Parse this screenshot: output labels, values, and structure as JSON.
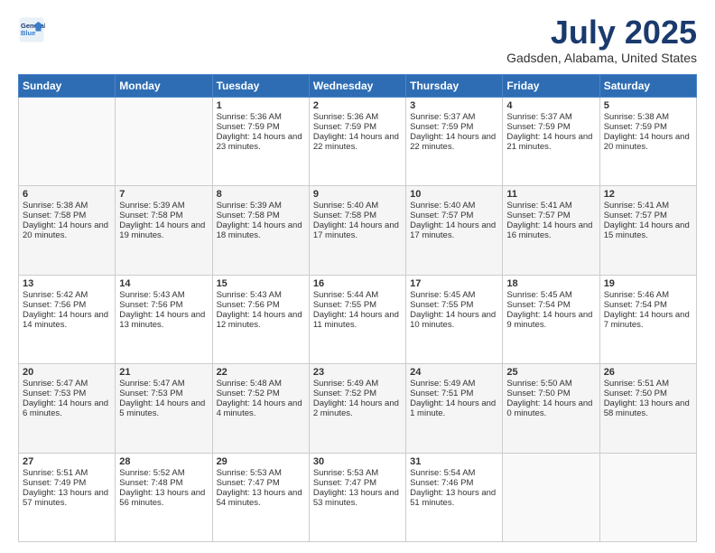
{
  "logo": {
    "line1": "General",
    "line2": "Blue"
  },
  "title": "July 2025",
  "subtitle": "Gadsden, Alabama, United States",
  "days_header": [
    "Sunday",
    "Monday",
    "Tuesday",
    "Wednesday",
    "Thursday",
    "Friday",
    "Saturday"
  ],
  "weeks": [
    [
      null,
      null,
      {
        "day": 1,
        "sunrise": "5:36 AM",
        "sunset": "7:59 PM",
        "daylight": "14 hours and 23 minutes."
      },
      {
        "day": 2,
        "sunrise": "5:36 AM",
        "sunset": "7:59 PM",
        "daylight": "14 hours and 22 minutes."
      },
      {
        "day": 3,
        "sunrise": "5:37 AM",
        "sunset": "7:59 PM",
        "daylight": "14 hours and 22 minutes."
      },
      {
        "day": 4,
        "sunrise": "5:37 AM",
        "sunset": "7:59 PM",
        "daylight": "14 hours and 21 minutes."
      },
      {
        "day": 5,
        "sunrise": "5:38 AM",
        "sunset": "7:59 PM",
        "daylight": "14 hours and 20 minutes."
      }
    ],
    [
      {
        "day": 6,
        "sunrise": "5:38 AM",
        "sunset": "7:58 PM",
        "daylight": "14 hours and 20 minutes."
      },
      {
        "day": 7,
        "sunrise": "5:39 AM",
        "sunset": "7:58 PM",
        "daylight": "14 hours and 19 minutes."
      },
      {
        "day": 8,
        "sunrise": "5:39 AM",
        "sunset": "7:58 PM",
        "daylight": "14 hours and 18 minutes."
      },
      {
        "day": 9,
        "sunrise": "5:40 AM",
        "sunset": "7:58 PM",
        "daylight": "14 hours and 17 minutes."
      },
      {
        "day": 10,
        "sunrise": "5:40 AM",
        "sunset": "7:57 PM",
        "daylight": "14 hours and 17 minutes."
      },
      {
        "day": 11,
        "sunrise": "5:41 AM",
        "sunset": "7:57 PM",
        "daylight": "14 hours and 16 minutes."
      },
      {
        "day": 12,
        "sunrise": "5:41 AM",
        "sunset": "7:57 PM",
        "daylight": "14 hours and 15 minutes."
      }
    ],
    [
      {
        "day": 13,
        "sunrise": "5:42 AM",
        "sunset": "7:56 PM",
        "daylight": "14 hours and 14 minutes."
      },
      {
        "day": 14,
        "sunrise": "5:43 AM",
        "sunset": "7:56 PM",
        "daylight": "14 hours and 13 minutes."
      },
      {
        "day": 15,
        "sunrise": "5:43 AM",
        "sunset": "7:56 PM",
        "daylight": "14 hours and 12 minutes."
      },
      {
        "day": 16,
        "sunrise": "5:44 AM",
        "sunset": "7:55 PM",
        "daylight": "14 hours and 11 minutes."
      },
      {
        "day": 17,
        "sunrise": "5:45 AM",
        "sunset": "7:55 PM",
        "daylight": "14 hours and 10 minutes."
      },
      {
        "day": 18,
        "sunrise": "5:45 AM",
        "sunset": "7:54 PM",
        "daylight": "14 hours and 9 minutes."
      },
      {
        "day": 19,
        "sunrise": "5:46 AM",
        "sunset": "7:54 PM",
        "daylight": "14 hours and 7 minutes."
      }
    ],
    [
      {
        "day": 20,
        "sunrise": "5:47 AM",
        "sunset": "7:53 PM",
        "daylight": "14 hours and 6 minutes."
      },
      {
        "day": 21,
        "sunrise": "5:47 AM",
        "sunset": "7:53 PM",
        "daylight": "14 hours and 5 minutes."
      },
      {
        "day": 22,
        "sunrise": "5:48 AM",
        "sunset": "7:52 PM",
        "daylight": "14 hours and 4 minutes."
      },
      {
        "day": 23,
        "sunrise": "5:49 AM",
        "sunset": "7:52 PM",
        "daylight": "14 hours and 2 minutes."
      },
      {
        "day": 24,
        "sunrise": "5:49 AM",
        "sunset": "7:51 PM",
        "daylight": "14 hours and 1 minute."
      },
      {
        "day": 25,
        "sunrise": "5:50 AM",
        "sunset": "7:50 PM",
        "daylight": "14 hours and 0 minutes."
      },
      {
        "day": 26,
        "sunrise": "5:51 AM",
        "sunset": "7:50 PM",
        "daylight": "13 hours and 58 minutes."
      }
    ],
    [
      {
        "day": 27,
        "sunrise": "5:51 AM",
        "sunset": "7:49 PM",
        "daylight": "13 hours and 57 minutes."
      },
      {
        "day": 28,
        "sunrise": "5:52 AM",
        "sunset": "7:48 PM",
        "daylight": "13 hours and 56 minutes."
      },
      {
        "day": 29,
        "sunrise": "5:53 AM",
        "sunset": "7:47 PM",
        "daylight": "13 hours and 54 minutes."
      },
      {
        "day": 30,
        "sunrise": "5:53 AM",
        "sunset": "7:47 PM",
        "daylight": "13 hours and 53 minutes."
      },
      {
        "day": 31,
        "sunrise": "5:54 AM",
        "sunset": "7:46 PM",
        "daylight": "13 hours and 51 minutes."
      },
      null,
      null
    ]
  ],
  "labels": {
    "sunrise": "Sunrise:",
    "sunset": "Sunset:",
    "daylight": "Daylight:"
  }
}
